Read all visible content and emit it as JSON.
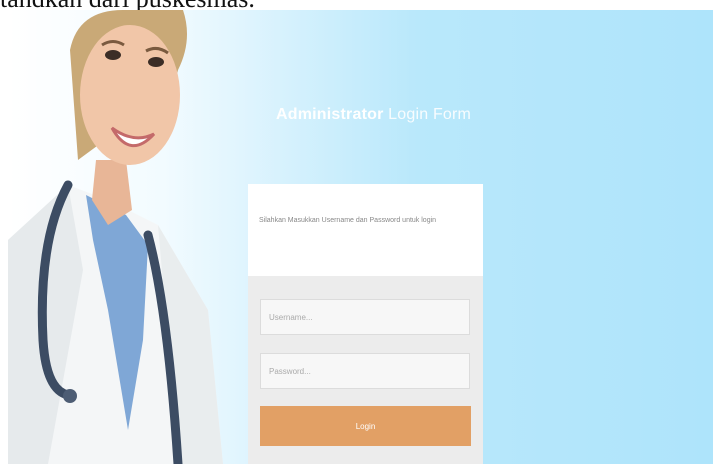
{
  "caption": {
    "text": "tandkan dari puskesmas."
  },
  "header": {
    "title_strong": "Administrator",
    "title_light": "Login Form"
  },
  "login": {
    "message": "Silahkan Masukkan Username dan Password untuk login",
    "username_placeholder": "Username...",
    "password_placeholder": "Password...",
    "button_label": "Login"
  },
  "colors": {
    "background_blue": "#aee4fb",
    "button": "#e2a065",
    "card_body": "#ececec",
    "card_head": "#ffffff"
  }
}
